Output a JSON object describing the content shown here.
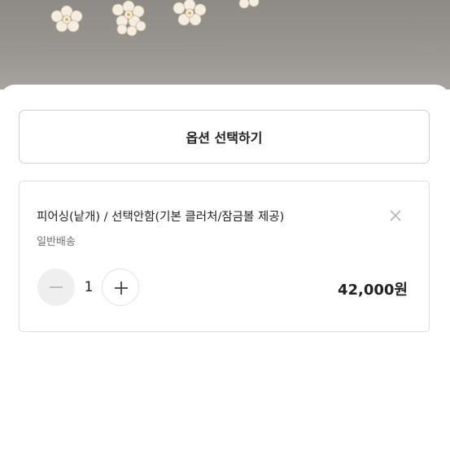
{
  "product_image": {
    "description_icon": "pearl-flower-earring-photo"
  },
  "option_select": {
    "label": "옵션 선택하기"
  },
  "selected_item": {
    "name": "피어싱(낱개) / 선택안함(기본 클러처/잠금볼 제공)",
    "shipping": "일반배송",
    "quantity": "1",
    "price": "42,000원"
  },
  "icons": {
    "remove": "close-icon",
    "decrement": "minus-icon",
    "increment": "plus-icon"
  }
}
